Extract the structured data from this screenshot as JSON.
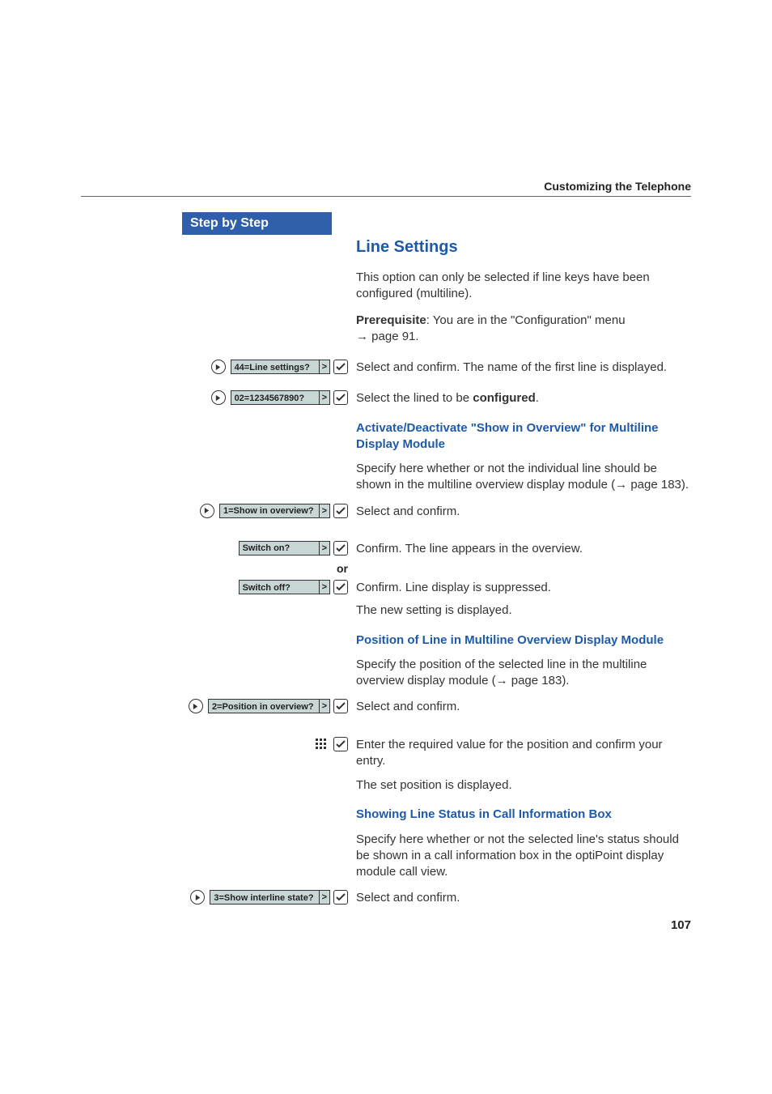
{
  "running_head": "Customizing the Telephone",
  "sidebar_title": "Step by Step",
  "page_number": "107",
  "section": {
    "title": "Line Settings",
    "intro1": "This option can only be selected if line keys have been configured (multiline).",
    "prereq_label": "Prerequisite",
    "prereq_rest": ": You are in the \"Configuration\" menu ",
    "prereq_pageref": "page 91.",
    "row1_text": "Select and confirm. The name of the first line is displayed.",
    "row2_text_a": "Select the lined to be ",
    "row2_bold": "configured",
    "row2_text_b": ".",
    "sub1_title": "Activate/Deactivate \"Show in Overview\" for Multiline Display Module",
    "sub1_para": "Specify here whether or not the individual line should be shown in the multiline overview display module (",
    "sub1_pageref": "page 183).",
    "row3_text": "Select and confirm.",
    "row4_text": "Confirm. The line appears in the overview.",
    "or_label": "or",
    "row5_text": "Confirm. Line display is suppressed.",
    "row5b_text": "The new setting is displayed.",
    "sub2_title": "Position of Line in Multiline Overview Display Module",
    "sub2_para": "Specify the position of the selected line in the multiline overview display module (",
    "sub2_pageref": "page 183).",
    "row6_text": "Select and confirm.",
    "row7_text": "Enter the required value for the position and confirm your entry.",
    "row7b_text": "The set position is displayed.",
    "sub3_title": "Showing Line Status in Call Information Box",
    "sub3_para": "Specify here whether or not the selected line's status should be shown in a call information box in the optiPoint display module call view.",
    "row8_text": "Select and confirm."
  },
  "displays": {
    "d1": "44=Line settings?",
    "d2": "02=1234567890?",
    "d3": "1=Show in overview?",
    "d4": "Switch on?",
    "d5": "Switch off?",
    "d6": "2=Position in overview?",
    "d7": "3=Show interline state?"
  }
}
